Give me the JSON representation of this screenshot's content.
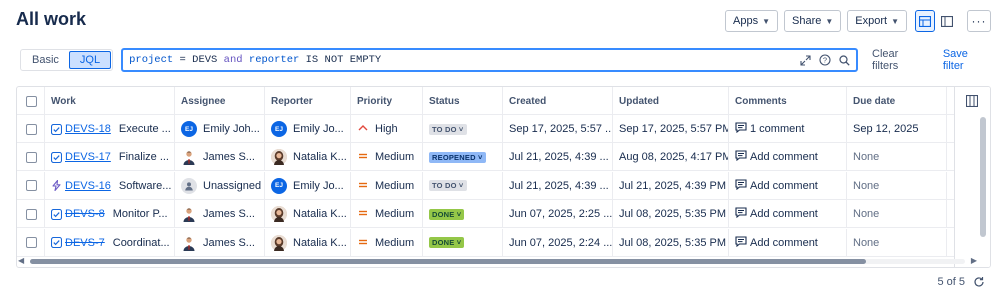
{
  "page": {
    "title": "All work"
  },
  "toolbar": {
    "apps_label": "Apps",
    "share_label": "Share",
    "export_label": "Export",
    "view_list_icon": "list-view-icon",
    "view_detail_icon": "detail-view-icon",
    "more_icon": "more-icon"
  },
  "filter": {
    "basic_label": "Basic",
    "jql_label": "JQL",
    "query_parts": [
      "project",
      "=",
      "DEVS",
      "and",
      "reporter",
      "IS NOT EMPTY"
    ],
    "clear_label": "Clear filters",
    "save_label": "Save filter"
  },
  "table": {
    "columns": [
      "Work",
      "Assignee",
      "Reporter",
      "Priority",
      "Status",
      "Created",
      "Updated",
      "Comments",
      "Due date"
    ],
    "rows": [
      {
        "type": "task",
        "key": "DEVS-18",
        "key_done": false,
        "summary": "Execute ...",
        "assignee": "Emily Joh...",
        "assignee_avatar": "EJ",
        "assignee_kind": "initials",
        "reporter": "Emily Jo...",
        "reporter_avatar": "EJ",
        "reporter_kind": "initials",
        "priority": "High",
        "status": "TO DO",
        "status_kind": "todo",
        "created": "Sep 17, 2025, 5:57 ...",
        "updated": "Sep 17, 2025, 5:57 PM",
        "comments": "1 comment",
        "due": "Sep 12, 2025"
      },
      {
        "type": "task",
        "key": "DEVS-17",
        "key_done": false,
        "summary": "Finalize ...",
        "assignee": "James S...",
        "assignee_avatar": "",
        "assignee_kind": "suit",
        "reporter": "Natalia K...",
        "reporter_avatar": "",
        "reporter_kind": "woman",
        "priority": "Medium",
        "status": "REOPENED",
        "status_kind": "reopen",
        "created": "Jul 21, 2025, 4:39 ...",
        "updated": "Aug 08, 2025, 4:17 PM",
        "comments": "Add comment",
        "due": "None"
      },
      {
        "type": "epic",
        "key": "DEVS-16",
        "key_done": false,
        "summary": "Software...",
        "assignee": "Unassigned",
        "assignee_avatar": "",
        "assignee_kind": "unassigned",
        "reporter": "Emily Jo...",
        "reporter_avatar": "EJ",
        "reporter_kind": "initials",
        "priority": "Medium",
        "status": "TO DO",
        "status_kind": "todo",
        "created": "Jul 21, 2025, 4:39 ...",
        "updated": "Jul 21, 2025, 4:39 PM",
        "comments": "Add comment",
        "due": "None"
      },
      {
        "type": "task",
        "key": "DEVS-8",
        "key_done": true,
        "summary": "Monitor P...",
        "assignee": "James S...",
        "assignee_avatar": "",
        "assignee_kind": "suit",
        "reporter": "Natalia K...",
        "reporter_avatar": "",
        "reporter_kind": "woman",
        "priority": "Medium",
        "status": "DONE",
        "status_kind": "done",
        "created": "Jun 07, 2025, 2:25 ...",
        "updated": "Jul 08, 2025, 5:35 PM",
        "comments": "Add comment",
        "due": "None"
      },
      {
        "type": "task",
        "key": "DEVS-7",
        "key_done": true,
        "summary": "Coordinat...",
        "assignee": "James S...",
        "assignee_avatar": "",
        "assignee_kind": "suit",
        "reporter": "Natalia K...",
        "reporter_avatar": "",
        "reporter_kind": "woman",
        "priority": "Medium",
        "status": "DONE",
        "status_kind": "done",
        "created": "Jun 07, 2025, 2:24 ...",
        "updated": "Jul 08, 2025, 5:35 PM",
        "comments": "Add comment",
        "due": "None"
      }
    ]
  },
  "footer": {
    "count_label": "5 of 5"
  },
  "colors": {
    "accent": "#0c66e4",
    "done": "#94c748",
    "reopened": "#8fb8f6",
    "todo": "#dfe1e6",
    "high_priority": "#e2483d",
    "medium_priority": "#e56910"
  }
}
